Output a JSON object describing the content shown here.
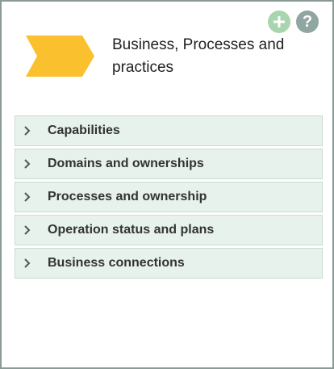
{
  "header": {
    "title": "Business, Processes and practices",
    "banner_color": "#fbc02d",
    "banner_icon": "chevron-banner-icon",
    "actions": [
      {
        "name": "add",
        "icon": "plus-icon",
        "color": "#a8d5ae"
      },
      {
        "name": "help",
        "icon": "question-icon",
        "glyph": "?",
        "color": "#8fa6a2"
      }
    ]
  },
  "items": [
    {
      "label": "Capabilities",
      "icon": "chevron-right-icon"
    },
    {
      "label": "Domains and ownerships",
      "icon": "chevron-right-icon"
    },
    {
      "label": "Processes and ownership",
      "icon": "chevron-right-icon"
    },
    {
      "label": "Operation status and plans",
      "icon": "chevron-right-icon"
    },
    {
      "label": "Business connections",
      "icon": "chevron-right-icon"
    }
  ],
  "colors": {
    "item_background": "#e6f2eb",
    "item_border": "#c9ddd1",
    "panel_border": "#8a9a96"
  }
}
